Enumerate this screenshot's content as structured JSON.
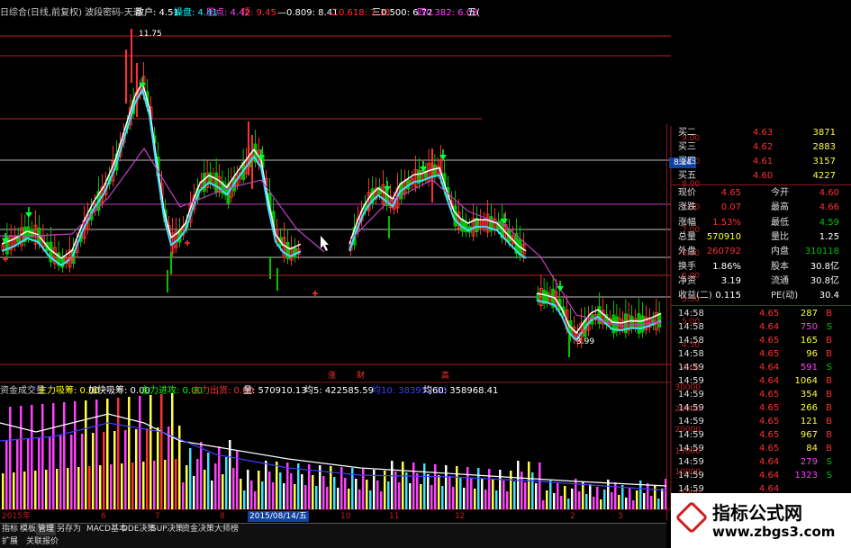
{
  "header": {
    "title": "日综合(日线,前复权) 波段密码-天道",
    "items": [
      {
        "text": "散户: 4.51",
        "color": "#ffffff"
      },
      {
        "text": "操盘: 4.41",
        "color": "#00ffff"
      },
      {
        "text": "压点: 4.42",
        "color": "#ff40ff"
      },
      {
        "text": "顶: 9.45",
        "color": "#ff3030"
      },
      {
        "text": "—0.809: 8.41",
        "color": "#ffffff"
      },
      {
        "text": "二0.618: 7.38",
        "color": "#ff3030"
      },
      {
        "text": "三0.500: 6.72",
        "color": "#ffffff"
      },
      {
        "text": "四0.382: 6.08",
        "color": "#ff40ff"
      },
      {
        "text": "五(",
        "color": "#ffffff"
      }
    ]
  },
  "price_chart": {
    "high_label": "11.75",
    "low_label": "3.99",
    "marker_labels": [
      "涨",
      "财",
      "高"
    ]
  },
  "price_axis": [
    "9.00",
    "8.50",
    "8.00",
    "7.50",
    "7.00",
    "6.50",
    "6.00",
    "5.50",
    "5.00",
    "4.50",
    "4.00"
  ],
  "crosshair_value": "8.24",
  "indicator_header": {
    "name": "资金成交量",
    "items": [
      {
        "text": "主力吸筹: 0.00",
        "color": "#ffff00"
      },
      {
        "text": "加快吸筹: 0.00",
        "color": "#ffffff"
      },
      {
        "text": "主力进攻: 0.00",
        "color": "#00ff00"
      },
      {
        "text": "主力出货: 0.00",
        "color": "#ff3030"
      },
      {
        "text": "量: 570910.13",
        "color": "#ffffff"
      },
      {
        "text": "均5: 422585.59",
        "color": "#ffffff"
      },
      {
        "text": "均10: 383952.00",
        "color": "#4040ff"
      },
      {
        "text": "均60: 358968.41",
        "color": "#ffffff"
      }
    ]
  },
  "volume_axis": [
    "30000",
    "25000",
    "20000",
    "15000",
    "10000",
    "5000"
  ],
  "date_axis": [
    {
      "text": "2015年",
      "boxed": false
    },
    {
      "text": "6",
      "boxed": false
    },
    {
      "text": "7",
      "boxed": false
    },
    {
      "text": "8",
      "boxed": false
    },
    {
      "text": "2015/08/14/五",
      "boxed": true
    },
    {
      "text": "10",
      "boxed": false
    },
    {
      "text": "11",
      "boxed": false
    },
    {
      "text": "12",
      "boxed": false
    },
    {
      "text": "2",
      "boxed": false
    },
    {
      "text": "3",
      "boxed": false
    }
  ],
  "tabs": [
    "指标",
    "模板",
    "管理",
    "另存为",
    "MACD基本",
    "DDE决策",
    "SUP决策",
    "资金决策",
    "大师榜"
  ],
  "bottom_tabs": [
    "扩展",
    "关联报价"
  ],
  "order_book": [
    {
      "label": "买二",
      "price": "4.63",
      "vol": "3871"
    },
    {
      "label": "买三",
      "price": "4.62",
      "vol": "2883"
    },
    {
      "label": "买四",
      "price": "4.61",
      "vol": "3157"
    },
    {
      "label": "买五",
      "price": "4.60",
      "vol": "4227"
    }
  ],
  "quote": [
    {
      "l1": "现价",
      "v1": "4.65",
      "l2": "今开",
      "v2": "4.60"
    },
    {
      "l1": "涨跌",
      "v1": "0.07",
      "l2": "最高",
      "v2": "4.66"
    },
    {
      "l1": "涨幅",
      "v1": "1.53%",
      "l2": "最低",
      "v2": "4.59"
    },
    {
      "l1": "总量",
      "v1": "570910",
      "l2": "量比",
      "v2": "1.25"
    },
    {
      "l1": "外盘",
      "v1": "260792",
      "l2": "内盘",
      "v2": "310118"
    },
    {
      "l1": "换手",
      "v1": "1.86%",
      "l2": "股本",
      "v2": "30.8亿"
    },
    {
      "l1": "净资",
      "v1": "3.19",
      "l2": "流通",
      "v2": "30.8亿"
    },
    {
      "l1": "收益(二)",
      "v1": "0.115",
      "l2": "PE(动)",
      "v2": "30.4"
    }
  ],
  "ticks": [
    {
      "time": "14:58",
      "price": "4.65",
      "vol": "287",
      "side": "B"
    },
    {
      "time": "14:58",
      "price": "4.64",
      "vol": "750",
      "side": "S"
    },
    {
      "time": "14:58",
      "price": "4.65",
      "vol": "165",
      "side": "B"
    },
    {
      "time": "14:58",
      "price": "4.65",
      "vol": "96",
      "side": "B"
    },
    {
      "time": "14:59",
      "price": "4.64",
      "vol": "591",
      "side": "S"
    },
    {
      "time": "14:59",
      "price": "4.64",
      "vol": "1064",
      "side": "B"
    },
    {
      "time": "14:59",
      "price": "4.65",
      "vol": "354",
      "side": "B"
    },
    {
      "time": "14:59",
      "price": "4.65",
      "vol": "266",
      "side": "B"
    },
    {
      "time": "14:59",
      "price": "4.65",
      "vol": "121",
      "side": "B"
    },
    {
      "time": "14:59",
      "price": "4.65",
      "vol": "967",
      "side": "B"
    },
    {
      "time": "14:59",
      "price": "4.65",
      "vol": "84",
      "side": "B"
    },
    {
      "time": "14:59",
      "price": "4.64",
      "vol": "279",
      "side": "S"
    },
    {
      "time": "14:59",
      "price": "4.64",
      "vol": "1323",
      "side": "S"
    },
    {
      "time": "14:59",
      "price": "4.64",
      "vol": "",
      "side": ""
    }
  ],
  "watermark": {
    "title": "指标公式网",
    "url": "www.zbgs3.com"
  },
  "colors": {
    "up": "#ff3030",
    "down": "#00c000",
    "ma_white": "#ffffff",
    "ma_cyan": "#40e0ff",
    "ma_purple": "#c040c0"
  }
}
